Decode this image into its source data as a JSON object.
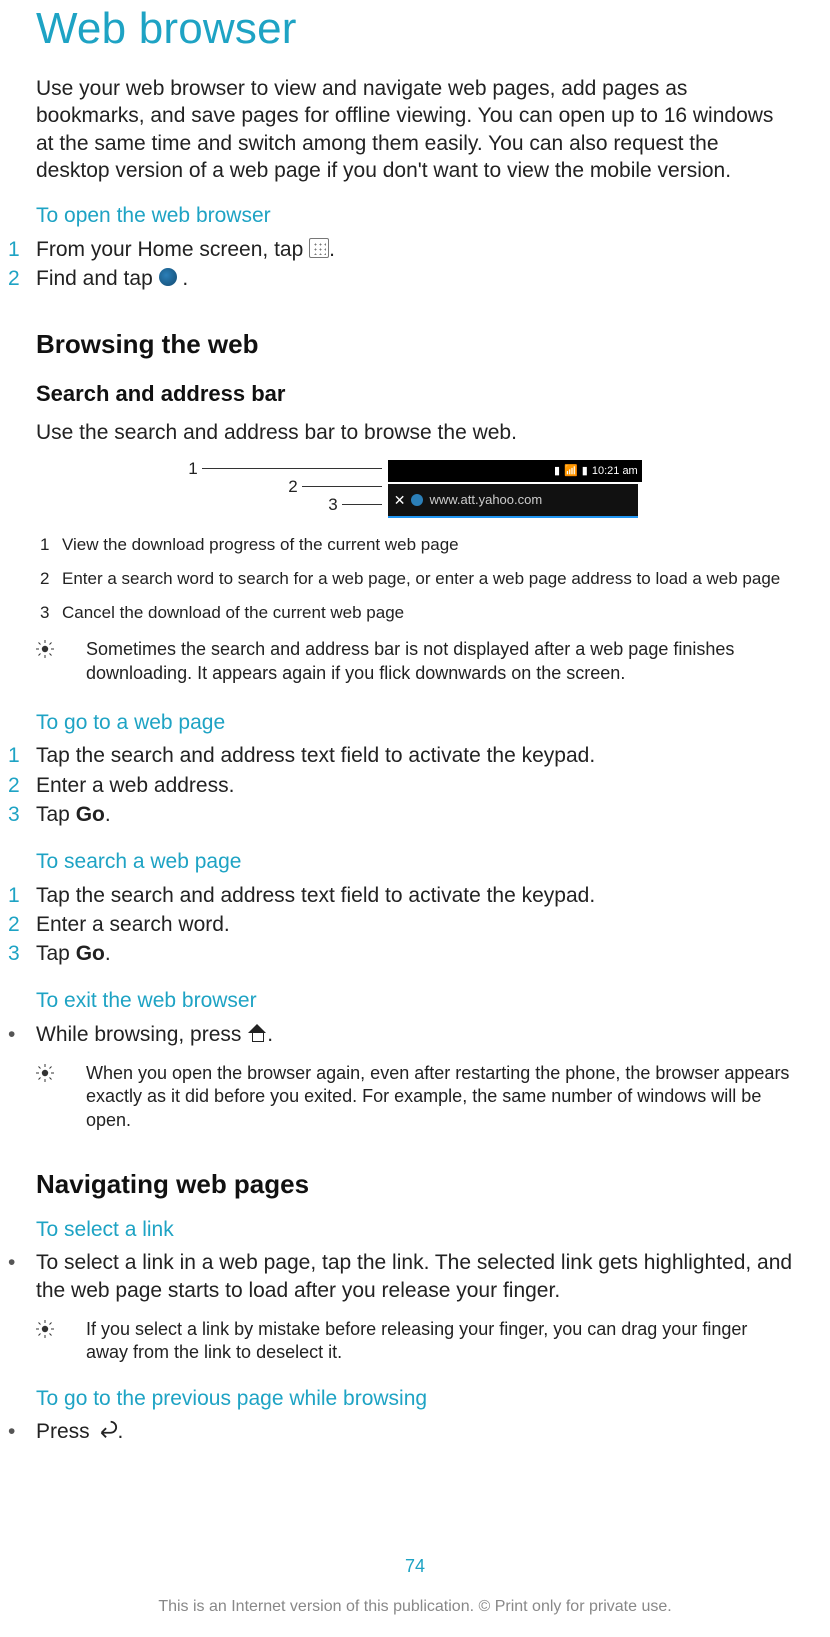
{
  "title": "Web browser",
  "intro": "Use your web browser to view and navigate web pages, add pages as bookmarks, and save pages for offline viewing. You can open up to 16 windows at the same time and switch among them easily. You can also request the desktop version of a web page if you don't want to view the mobile version.",
  "open_browser": {
    "heading": "To open the web browser",
    "steps": [
      {
        "n": "1",
        "before": "From your Home screen, tap ",
        "after": "."
      },
      {
        "n": "2",
        "before": "Find and tap ",
        "after": " ."
      }
    ]
  },
  "browsing_heading": "Browsing the web",
  "search_bar": {
    "heading": "Search and address bar",
    "desc": "Use the search and address bar to browse the web.",
    "callouts": [
      "1",
      "2",
      "3"
    ],
    "status_text": "10:21 am",
    "url_text": "www.att.yahoo.com",
    "legend": [
      {
        "n": "1",
        "t": "View the download progress of the current web page"
      },
      {
        "n": "2",
        "t": "Enter a search word to search for a web page, or enter a web page address to load a web page"
      },
      {
        "n": "3",
        "t": "Cancel the download of the current web page"
      }
    ],
    "tip": "Sometimes the search and address bar is not displayed after a web page finishes downloading. It appears again if you flick downwards on the screen."
  },
  "go_page": {
    "heading": "To go to a web page",
    "steps": [
      {
        "n": "1",
        "t": "Tap the search and address text field to activate the keypad."
      },
      {
        "n": "2",
        "t": "Enter a web address."
      },
      {
        "n": "3",
        "before": "Tap ",
        "bold": "Go",
        "after": "."
      }
    ]
  },
  "search_page": {
    "heading": "To search a web page",
    "steps": [
      {
        "n": "1",
        "t": "Tap the search and address text field to activate the keypad."
      },
      {
        "n": "2",
        "t": "Enter a search word."
      },
      {
        "n": "3",
        "before": "Tap ",
        "bold": "Go",
        "after": "."
      }
    ]
  },
  "exit_browser": {
    "heading": "To exit the web browser",
    "bullet_before": "While browsing, press ",
    "bullet_after": ".",
    "tip": "When you open the browser again, even after restarting the phone, the browser appears exactly as it did before you exited. For example, the same number of windows will be open."
  },
  "navigating_heading": "Navigating web pages",
  "select_link": {
    "heading": "To select a link",
    "bullet": "To select a link in a web page, tap the link. The selected link gets highlighted, and the web page starts to load after you release your finger.",
    "tip": "If you select a link by mistake before releasing your finger, you can drag your finger away from the link to deselect it."
  },
  "prev_page": {
    "heading": "To go to the previous page while browsing",
    "bullet_before": "Press ",
    "bullet_after": "."
  },
  "footer": {
    "page": "74",
    "notice": "This is an Internet version of this publication. © Print only for private use."
  }
}
